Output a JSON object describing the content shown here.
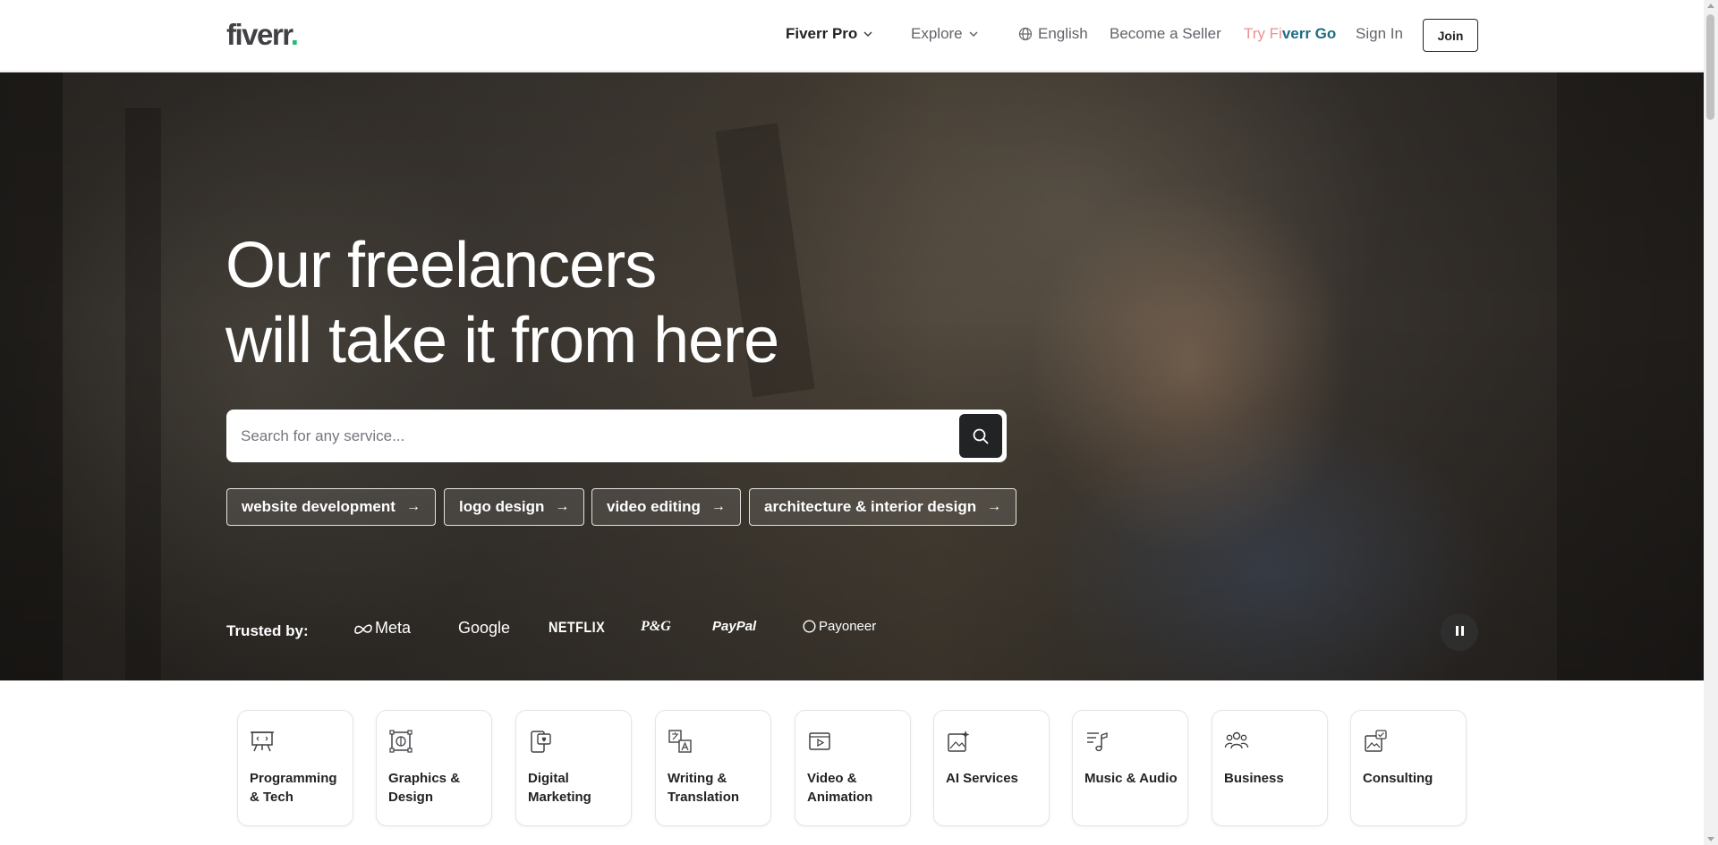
{
  "header": {
    "logo_text": "fiverr",
    "logo_dot": ".",
    "nav": {
      "fiverr_pro": "Fiverr Pro",
      "explore": "Explore",
      "language": "English",
      "become_seller": "Become a Seller",
      "try_go_a": "Try Fi",
      "try_go_b": "verr Go",
      "sign_in": "Sign In",
      "join": "Join"
    }
  },
  "hero": {
    "title_line1": "Our freelancers",
    "title_line2": "will take it from here",
    "search": {
      "placeholder": "Search for any service...",
      "value": ""
    },
    "chips": [
      {
        "label": "website development",
        "arrow": "→"
      },
      {
        "label": "logo design",
        "arrow": "→"
      },
      {
        "label": "video editing",
        "arrow": "→"
      },
      {
        "label": "architecture & interior design",
        "arrow": "→"
      }
    ],
    "trusted_label": "Trusted by:",
    "brands": [
      "Meta",
      "Google",
      "NETFLIX",
      "P&G",
      "PayPal",
      "Payoneer"
    ]
  },
  "categories": [
    {
      "label": "Programming & Tech",
      "icon": "presentation-board-icon"
    },
    {
      "label": "Graphics & Design",
      "icon": "design-frame-icon"
    },
    {
      "label": "Digital Marketing",
      "icon": "phone-heart-icon"
    },
    {
      "label": "Writing & Translation",
      "icon": "translate-icon"
    },
    {
      "label": "Video & Animation",
      "icon": "video-play-icon"
    },
    {
      "label": "AI Services",
      "icon": "ai-image-icon"
    },
    {
      "label": "Music & Audio",
      "icon": "music-note-icon"
    },
    {
      "label": "Business",
      "icon": "people-group-icon"
    },
    {
      "label": "Consulting",
      "icon": "consulting-image-icon"
    }
  ],
  "colors": {
    "brand_green": "#1dbf73",
    "text_dark": "#222325",
    "text_muted": "#62646a"
  }
}
